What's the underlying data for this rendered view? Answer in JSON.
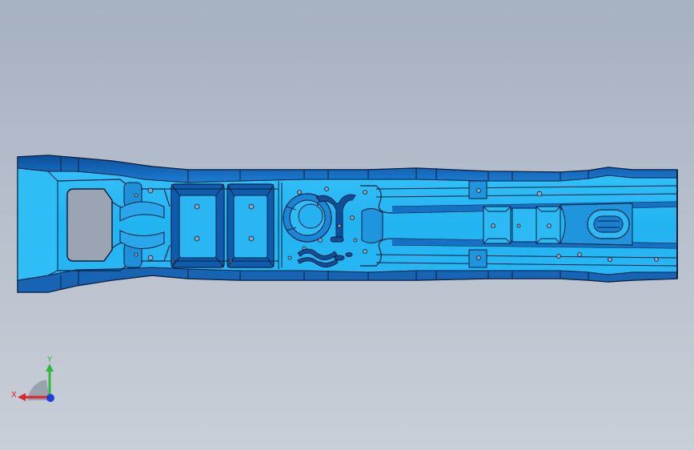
{
  "viewport": {
    "background_top": "#a6b1c1",
    "background_bottom": "#c9cfd8"
  },
  "model": {
    "part_color": "#27b7f4",
    "edge_color": "#0a1e3c",
    "shadow_color": "#0a5aa8",
    "cutout_color": "#9aa4b2"
  },
  "triad": {
    "x_label": "X",
    "y_label": "Y",
    "x_color": "#d8262c",
    "y_color": "#2fb83a",
    "z_color": "#1f3fd6"
  }
}
